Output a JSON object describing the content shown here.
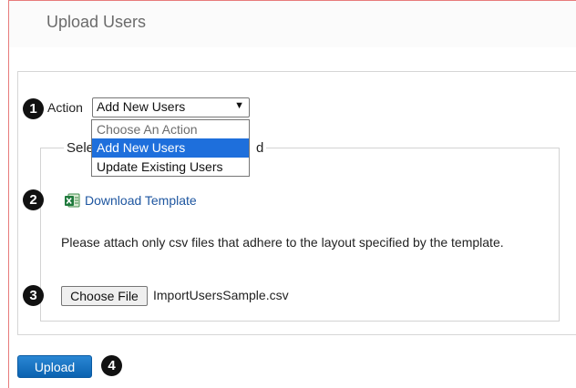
{
  "page": {
    "title": "Upload Users"
  },
  "action": {
    "label": "Action",
    "selected": "Add New Users",
    "options": [
      "Choose An Action",
      "Add New Users",
      "Update Existing Users"
    ]
  },
  "fieldset": {
    "legend_visible_start": "Sele",
    "legend_visible_end": "d"
  },
  "template": {
    "link_label": "Download Template",
    "icon": "excel-icon"
  },
  "note": {
    "text": "Please attach only csv files that adhere to the layout specified by the template."
  },
  "file": {
    "button_label": "Choose File",
    "file_name": "ImportUsersSample.csv"
  },
  "upload": {
    "button_label": "Upload"
  },
  "badges": [
    "1",
    "2",
    "3",
    "4"
  ],
  "colors": {
    "badge": "#111111",
    "selected_option": "#1e6fdc",
    "link": "#1e56a0",
    "upload_button": "#1a74c4"
  }
}
